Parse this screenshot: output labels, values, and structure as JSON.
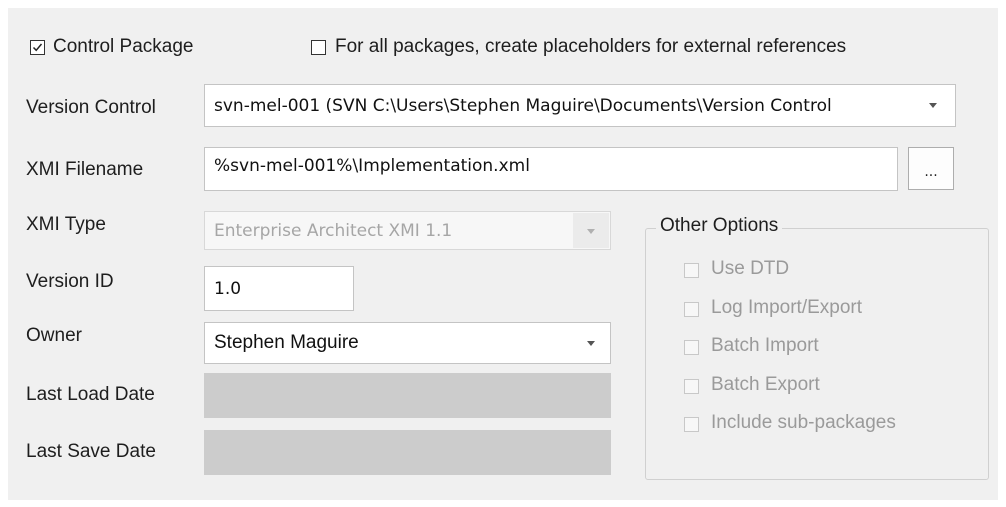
{
  "top_options": {
    "control_package": {
      "label": "Control Package",
      "checked": true
    },
    "create_placeholders": {
      "label": "For all packages, create placeholders for external references",
      "checked": false
    }
  },
  "version_control": {
    "label": "Version Control",
    "value": "svn-mel-001 (SVN C:\\Users\\Stephen Maguire\\Documents\\Version Control"
  },
  "xmi_filename": {
    "label": "XMI Filename",
    "value": "%svn-mel-001%\\Implementation.xml",
    "browse_label": "..."
  },
  "xmi_type": {
    "label": "XMI Type",
    "value": "Enterprise Architect XMI 1.1"
  },
  "version_id": {
    "label": "Version ID",
    "value": "1.0"
  },
  "owner": {
    "label": "Owner",
    "value": "Stephen Maguire"
  },
  "last_load_date": {
    "label": "Last Load Date",
    "value": ""
  },
  "last_save_date": {
    "label": "Last Save Date",
    "value": ""
  },
  "other_options": {
    "title": "Other Options",
    "items": [
      {
        "label": "Use DTD",
        "checked": false
      },
      {
        "label": "Log Import/Export",
        "checked": false
      },
      {
        "label": "Batch Import",
        "checked": false
      },
      {
        "label": "Batch Export",
        "checked": false
      },
      {
        "label": "Include sub-packages",
        "checked": false
      }
    ]
  }
}
